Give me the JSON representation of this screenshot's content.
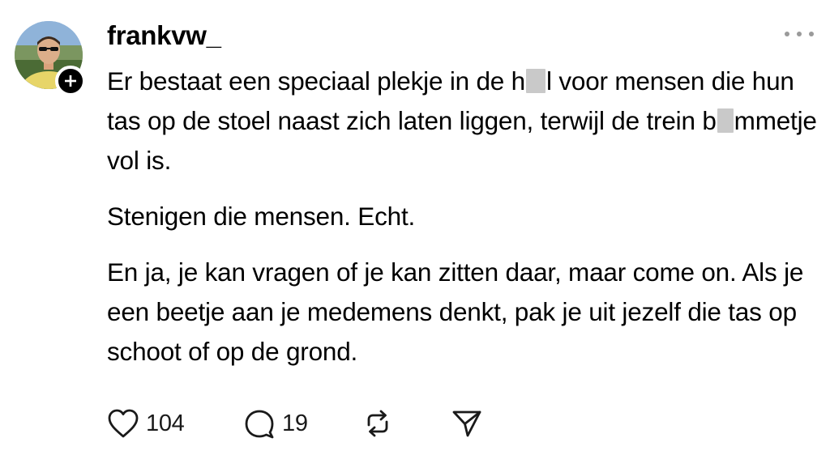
{
  "post": {
    "username": "frankvw_",
    "paragraphs": [
      {
        "segments": [
          {
            "type": "text",
            "text": "Er bestaat een speciaal plekje in de h"
          },
          {
            "type": "redacted"
          },
          {
            "type": "text",
            "text": "l voor mensen die hun tas op de stoel naast zich laten liggen, terwijl de trein b"
          },
          {
            "type": "redacted"
          },
          {
            "type": "text",
            "text": "mmetje vol is."
          }
        ]
      },
      {
        "segments": [
          {
            "type": "text",
            "text": "Stenigen die mensen. Echt."
          }
        ]
      },
      {
        "segments": [
          {
            "type": "text",
            "text": "En ja, je kan vragen of je kan zitten daar, maar come on. Als je een beetje aan je medemens denkt, pak je uit jezelf die tas op schoot of op de grond."
          }
        ]
      }
    ],
    "actions": {
      "like_count": "104",
      "reply_count": "19"
    }
  },
  "icons": {
    "follow": "plus-icon",
    "more": "more-horizontal-icon",
    "like": "heart-icon",
    "reply": "comment-bubble-icon",
    "repost": "repost-icon",
    "share": "send-icon"
  },
  "colors": {
    "text": "#000000",
    "muted": "#9a9a9a",
    "redaction": "#c9c9c9",
    "badge": "#000000"
  }
}
